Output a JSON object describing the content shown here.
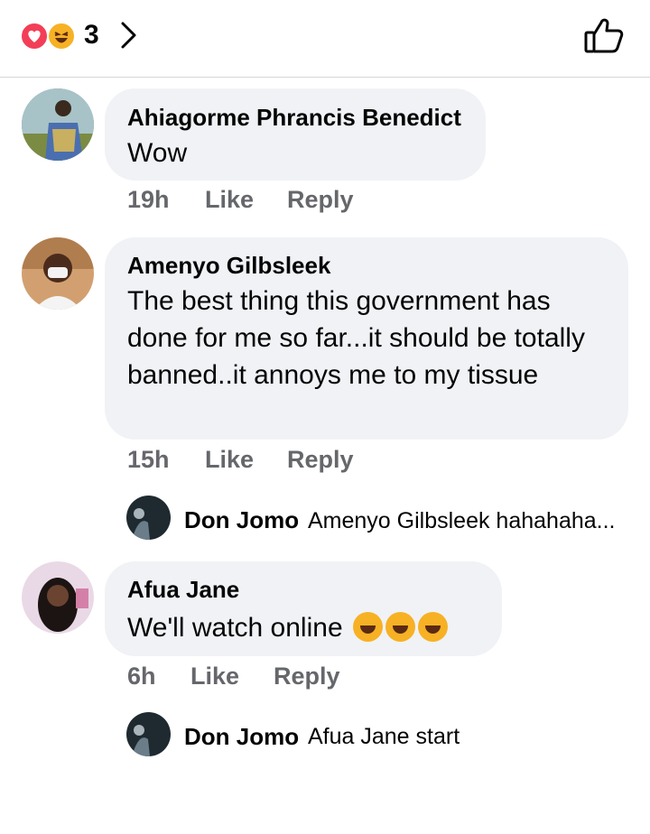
{
  "reactions": {
    "count": "3",
    "types": [
      "heart-icon",
      "haha-icon"
    ],
    "colors": {
      "heart": "#f33e58",
      "haha": "#f7b125"
    }
  },
  "comments": [
    {
      "author": "Ahiagorme Phrancis Benedict",
      "text": "Wow",
      "time": "19h",
      "like": "Like",
      "reply": "Reply"
    },
    {
      "author": "Amenyo Gilbsleek",
      "text": "The best thing this government has done for me so far...it should be totally banned..it annoys me to my tissue",
      "time": "15h",
      "like": "Like",
      "reply": "Reply",
      "reply_preview": {
        "author": "Don Jomo",
        "text": "Amenyo Gilbsleek hahahaha..."
      }
    },
    {
      "author": "Afua Jane",
      "text": "We'll watch online",
      "time": "6h",
      "like": "Like",
      "reply": "Reply",
      "reply_preview": {
        "author": "Don Jomo",
        "text": "Afua Jane start"
      }
    }
  ],
  "colors": {
    "bubble": "#f0f2f5",
    "meta": "#65676b",
    "divider": "#d6d6d6"
  }
}
